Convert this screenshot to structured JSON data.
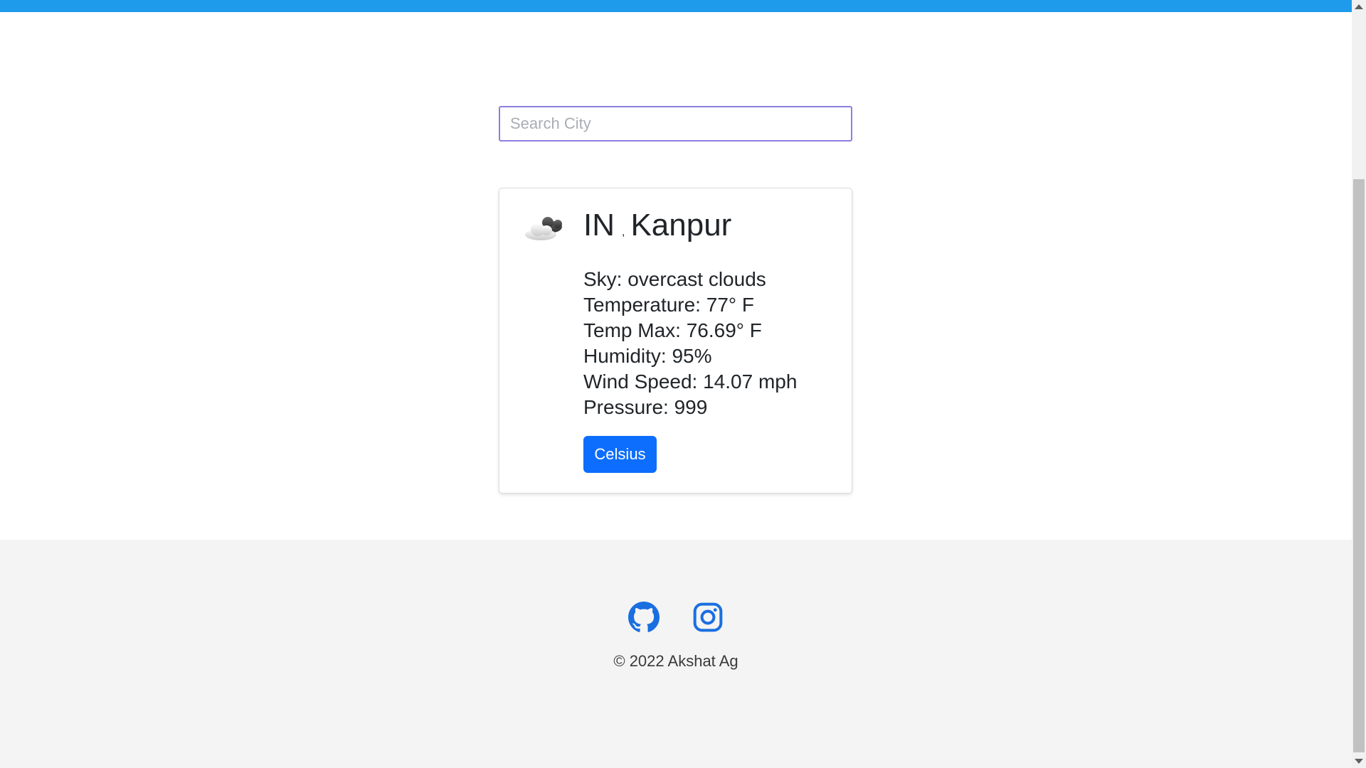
{
  "search": {
    "placeholder": "Search City",
    "value": ""
  },
  "weather": {
    "icon": "overcast-clouds-icon",
    "country": "IN",
    "separator": ",",
    "city": "Kanpur",
    "details": [
      "Sky: overcast clouds",
      "Temperature: 77° F",
      "Temp Max: 76.69° F",
      "Humidity: 95%",
      "Wind Speed: 14.07 mph",
      "Pressure: 999"
    ],
    "unit_button_label": "Celsius"
  },
  "footer": {
    "social": [
      "github-icon",
      "instagram-icon"
    ],
    "copyright": "© 2022 Akshat Ag"
  },
  "colors": {
    "topbar": "#1e9bea",
    "button": "#0d6efd",
    "icons": "#1a6fe0",
    "footer_bg": "#f4f4f4",
    "search_border": "#8b7fe0"
  }
}
